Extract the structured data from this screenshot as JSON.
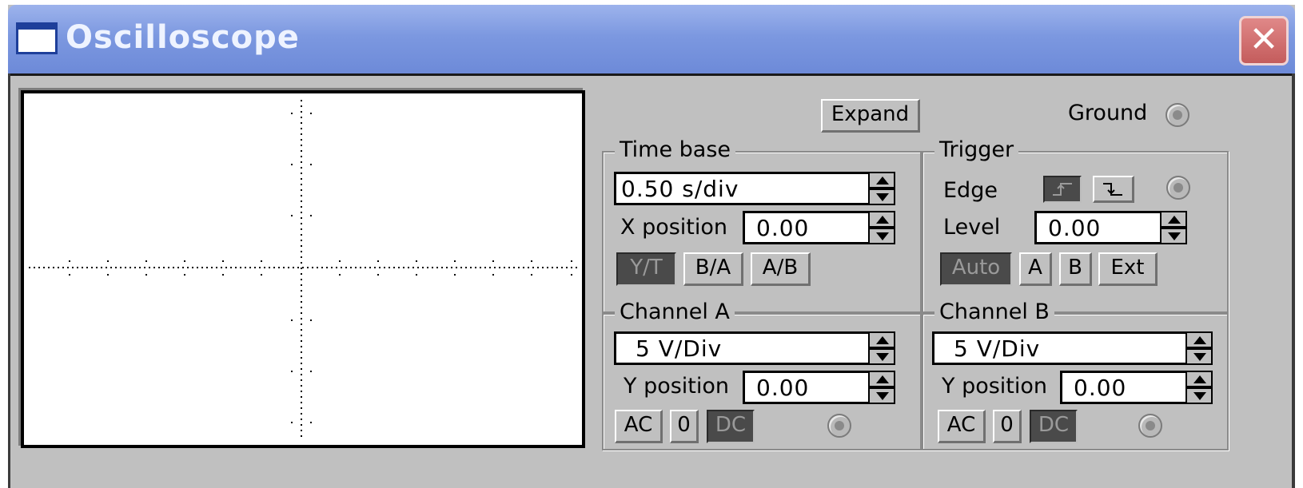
{
  "window": {
    "title": "Oscilloscope",
    "close_glyph": "✕",
    "icon": "window-icon"
  },
  "controls": {
    "expand_label": "Expand",
    "ground_label": "Ground"
  },
  "timebase": {
    "legend": "Time base",
    "value": "0.50 s/div",
    "x_position_label": "X position",
    "x_position_value": "0.00",
    "modes": [
      "Y/T",
      "B/A",
      "A/B"
    ],
    "active_mode": "Y/T"
  },
  "trigger": {
    "legend": "Trigger",
    "edge_label": "Edge",
    "level_label": "Level",
    "level_value": "0.00",
    "sources": [
      "Auto",
      "A",
      "B",
      "Ext"
    ],
    "active_source": "Auto"
  },
  "channel_a": {
    "legend": "Channel A",
    "value": "5  V/Div",
    "y_position_label": "Y position",
    "y_position_value": "0.00",
    "couplings": [
      "AC",
      "0",
      "DC"
    ],
    "active_coupling": "DC"
  },
  "channel_b": {
    "legend": "Channel B",
    "value": "5  V/Div",
    "y_position_label": "Y position",
    "y_position_value": "0.00",
    "couplings": [
      "AC",
      "0",
      "DC"
    ],
    "active_coupling": "DC"
  }
}
